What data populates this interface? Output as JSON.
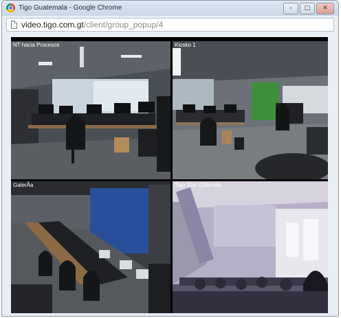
{
  "window": {
    "title": "Tigo Guatemala - Google Chrome",
    "controls": {
      "minimize": "–",
      "maximize": "□",
      "close": "✕"
    }
  },
  "address": {
    "url_host": "video.tigo.com.gt",
    "url_path": "/client/group_popup/4"
  },
  "cameras": [
    {
      "label": "NT hacia Procesos"
    },
    {
      "label": "Kiosko 1"
    },
    {
      "label": "GalerÃa"
    },
    {
      "label": "Tigo Star GManolis"
    }
  ],
  "colors": {
    "window_bg": "#e9eef5",
    "titlebar": "#c9d6e6",
    "close_button": "#d9a097",
    "video_bg": "#000000"
  },
  "icons": [
    "chrome-logo-icon",
    "page-icon",
    "minimize-icon",
    "maximize-icon",
    "close-icon"
  ]
}
